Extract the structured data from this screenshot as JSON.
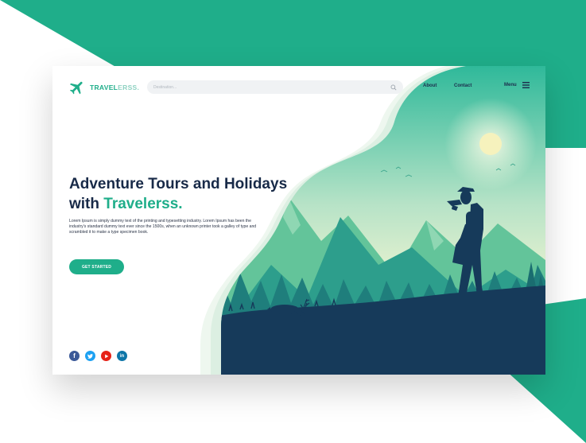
{
  "brand": {
    "name_part1": "TRAVEL",
    "name_part2": "ERSS."
  },
  "search": {
    "placeholder": "Destination..."
  },
  "nav": {
    "about": "About",
    "contact": "Contact",
    "menu": "Menu"
  },
  "hero": {
    "headline_line1": "Adventure Tours and Holidays",
    "headline_with": "with ",
    "headline_brand": "Travelerss.",
    "description": "Lorem Ipsum is simply dummy text of the printing and typesetting industry. Lorem Ipsum has been the industry's standard dummy text ever since the 1500s, when an unknown printer took a galley of type and scrambled it to make a type specimen book.",
    "cta": "GET STARTED"
  },
  "social": [
    {
      "network": "facebook",
      "letter": "f",
      "color": "#3b5998"
    },
    {
      "network": "twitter",
      "color": "#1da1f2"
    },
    {
      "network": "youtube",
      "color": "#e62117"
    },
    {
      "network": "linkedin",
      "letter": "in",
      "color": "#0e76a8"
    }
  ],
  "colors": {
    "accent": "#1fae8a",
    "headline": "#182a48",
    "background_green": "#1fae8a"
  },
  "icons": {
    "logo": "airplane-icon",
    "search": "search-icon",
    "menu": "hamburger-icon"
  }
}
